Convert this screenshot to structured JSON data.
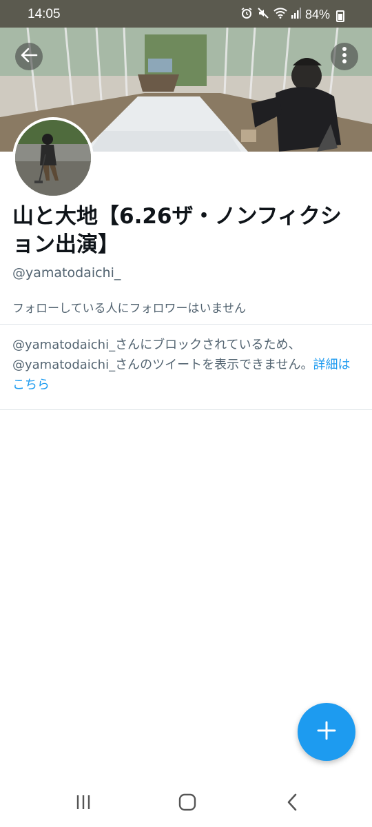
{
  "status_bar": {
    "time": "14:05",
    "battery": "84%",
    "icons": [
      "alarm-icon",
      "mute-icon",
      "wifi-icon",
      "signal-icon",
      "battery-icon"
    ]
  },
  "header": {
    "back_icon": "arrow-left-icon",
    "more_icon": "more-vertical-icon"
  },
  "profile": {
    "display_name": "山と大地【6.26ザ・ノンフィクション出演】",
    "handle": "@yamatodaichi_",
    "followers_note": "フォローしている人にフォロワーはいません"
  },
  "blocked": {
    "message": "@yamatodaichi_さんにブロックされているため、@yamatodaichi_さんのツイートを表示できません。",
    "link": "詳細はこちら"
  },
  "fab": {
    "icon": "plus-icon"
  },
  "nav_bar": {
    "icons": [
      "recent-apps-icon",
      "home-icon",
      "back-icon"
    ]
  },
  "colors": {
    "accent": "#1d9bf0",
    "status_bar": "#5b5a4f",
    "secondary_text": "#536471",
    "primary_text": "#0f1419"
  }
}
